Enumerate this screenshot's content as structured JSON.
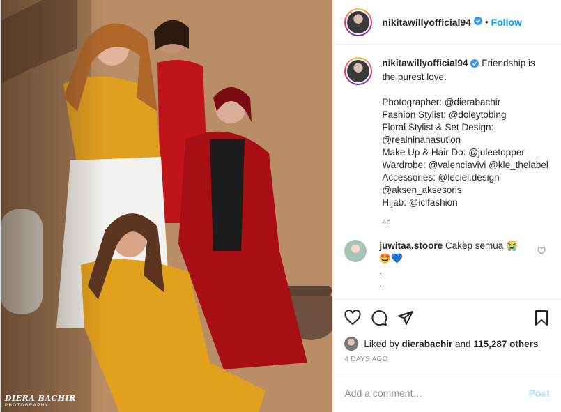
{
  "photo": {
    "watermark_line1": "DIERA BACHIR",
    "watermark_line2": "PHOTOGRAPHY"
  },
  "header": {
    "username": "nikitawillyofficial94",
    "separator": "•",
    "follow_label": "Follow"
  },
  "caption": {
    "username": "nikitawillyofficial94",
    "text": "Friendship is the purest love.\n\nPhotographer: @dierabachir\nFashion Stylist: @doleytobing\nFloral Stylist & Set Design: @realninanasution\nMake Up & Hair Do: @juleetopper\nWardrobe: @valenciavivi @kle_thelabel\nAccessories: @leciel.design\n@aksen_aksesoris\nHijab: @iclfashion",
    "time": "4d"
  },
  "comment": {
    "username": "juwitaa.stoore",
    "text": "Cakep semua 😭\n🤩💙\n.\n."
  },
  "likes": {
    "prefix": "Liked by",
    "user": "dierabachir",
    "and": "and",
    "count": "115,287 others"
  },
  "date": "4 DAYS AGO",
  "add_comment": {
    "placeholder": "Add a comment…",
    "post_label": "Post"
  },
  "colors": {
    "accent": "#0095f6",
    "post_disabled": "#b2dffc",
    "muted": "#8e8e8e"
  },
  "icons": [
    "verified-badge-icon",
    "heart-icon",
    "comment-icon",
    "share-icon",
    "bookmark-icon",
    "small-heart-icon"
  ]
}
